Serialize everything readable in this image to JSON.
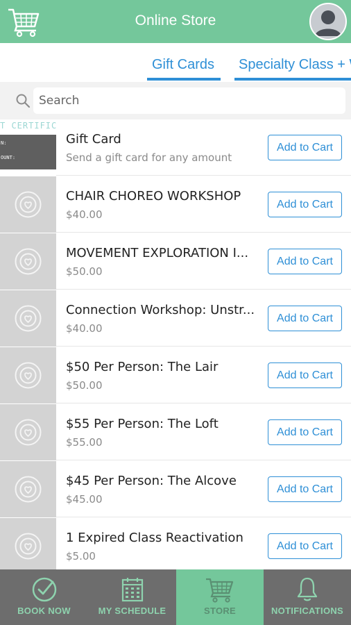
{
  "header": {
    "title": "Online Store"
  },
  "tabs": [
    {
      "label": "Gift Cards"
    },
    {
      "label": "Specialty Class + W"
    }
  ],
  "search": {
    "placeholder": "Search",
    "value": ""
  },
  "gift_thumb": {
    "top_text": "T CERTIFIC",
    "line1": "N:",
    "line2": "OUNT:"
  },
  "items": [
    {
      "title": "Gift Card",
      "subtitle": "Send a gift card for any amount",
      "button": "Add to Cart"
    },
    {
      "title": "CHAIR CHOREO WORKSHOP",
      "subtitle": "$40.00",
      "button": "Add to Cart"
    },
    {
      "title": "MOVEMENT EXPLORATION I...",
      "subtitle": "$50.00",
      "button": "Add to Cart"
    },
    {
      "title": "Connection Workshop: Unstr...",
      "subtitle": "$40.00",
      "button": "Add to Cart"
    },
    {
      "title": "$50 Per Person: The Lair",
      "subtitle": "$50.00",
      "button": "Add to Cart"
    },
    {
      "title": "$55 Per Person: The Loft",
      "subtitle": "$55.00",
      "button": "Add to Cart"
    },
    {
      "title": "$45 Per Person: The Alcove",
      "subtitle": "$45.00",
      "button": "Add to Cart"
    },
    {
      "title": "1 Expired Class Reactivation",
      "subtitle": "$5.00",
      "button": "Add to Cart"
    }
  ],
  "nav": [
    {
      "label": "BOOK NOW",
      "icon": "check-circle-icon"
    },
    {
      "label": "MY SCHEDULE",
      "icon": "calendar-icon"
    },
    {
      "label": "STORE",
      "icon": "cart-icon"
    },
    {
      "label": "NOTIFICATIONS",
      "icon": "bell-icon"
    }
  ],
  "colors": {
    "brand_green": "#74c79b",
    "accent_blue": "#2e8fd6",
    "nav_gray": "#6d6d6d"
  }
}
